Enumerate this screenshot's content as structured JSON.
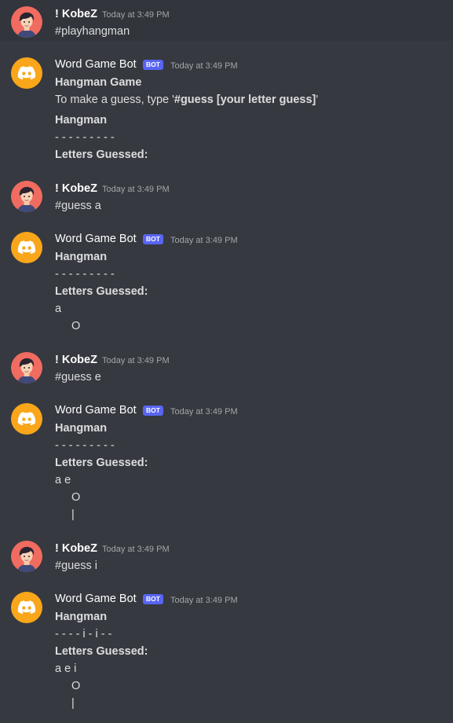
{
  "users": {
    "user_name": "! KobeZ",
    "bot_name": "Word Game Bot",
    "bot_tag": "BOT",
    "timestamp": "Today at 3:49 PM"
  },
  "messages": {
    "m1": {
      "text": "#playhangman"
    },
    "m2": {
      "title": "Hangman Game",
      "instr_pre": "To make a guess, type '",
      "instr_bold": "#guess [your letter guess]",
      "instr_post": "'",
      "section": "Hangman",
      "word": "- - - - - - - - -",
      "guessed_label": "Letters Guessed:"
    },
    "m3": {
      "text": "#guess a"
    },
    "m4": {
      "section": "Hangman",
      "word": "- - - - - - - - -",
      "guessed_label": "Letters Guessed:",
      "guessed": "a",
      "art1": "O"
    },
    "m5": {
      "text": "#guess e"
    },
    "m6": {
      "section": "Hangman",
      "word": "- - - - - - - - -",
      "guessed_label": "Letters Guessed:",
      "guessed": "a e",
      "art1": "O",
      "art2": "|"
    },
    "m7": {
      "text": "#guess i"
    },
    "m8": {
      "section": "Hangman",
      "word": "- - - - i - i - -",
      "guessed_label": "Letters Guessed:",
      "guessed": "a e i",
      "art1": "O",
      "art2": "|"
    }
  },
  "icons": {
    "user_avatar": "person-avatar-icon",
    "bot_avatar": "discord-logo-icon"
  },
  "colors": {
    "background": "#36393f",
    "bot_tag": "#5865f2",
    "bot_avatar": "#faa61a",
    "user_avatar": "#f06b60"
  }
}
